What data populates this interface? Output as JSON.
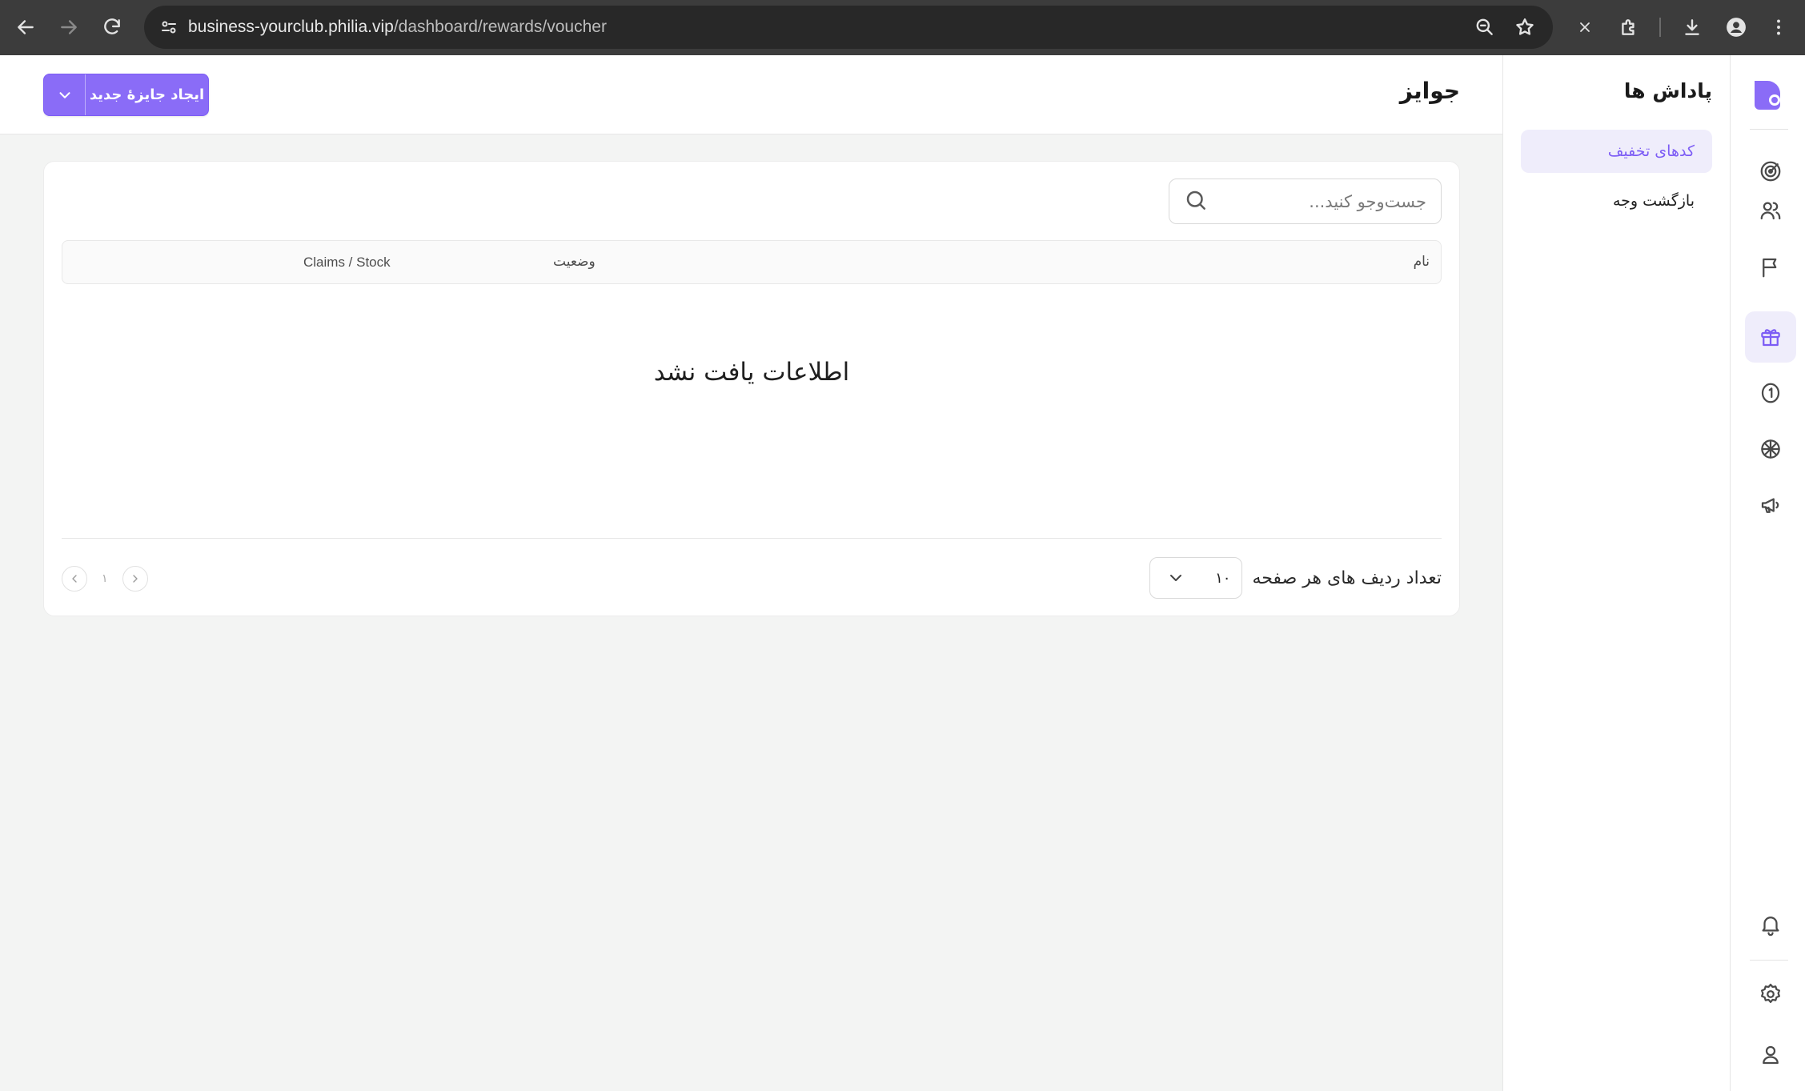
{
  "browser": {
    "url_host": "business-yourclub.philia.vip",
    "url_path": "/dashboard/rewards/voucher"
  },
  "rail": {
    "items": [
      {
        "icon": "target-icon"
      },
      {
        "icon": "users-icon"
      },
      {
        "icon": "flag-icon"
      },
      {
        "icon": "gift-icon",
        "active": true
      },
      {
        "icon": "coin-icon"
      },
      {
        "icon": "wheel-icon"
      },
      {
        "icon": "megaphone-icon"
      }
    ],
    "bottom": [
      {
        "icon": "bell-icon"
      },
      {
        "icon": "gear-icon"
      },
      {
        "icon": "user-icon"
      }
    ],
    "accent": "#7c5cf5"
  },
  "subnav": {
    "title": "پاداش ها",
    "items": [
      {
        "label": "کدهای تخفیف",
        "active": true
      },
      {
        "label": "بازگشت وجه",
        "active": false
      }
    ]
  },
  "header": {
    "title": "جوایز",
    "create_button": "ایجاد جایزهٔ جدید"
  },
  "table": {
    "search_placeholder": "جست‌وجو کنید...",
    "columns": {
      "name": "نام",
      "status": "وضعیت",
      "claims_stock": "Claims / Stock"
    },
    "empty_message": "اطلاعات یافت نشد",
    "rows_per_page_label": "تعداد ردیف های هر صفحه",
    "rows_per_page_value": "۱۰",
    "current_page": "۱"
  }
}
